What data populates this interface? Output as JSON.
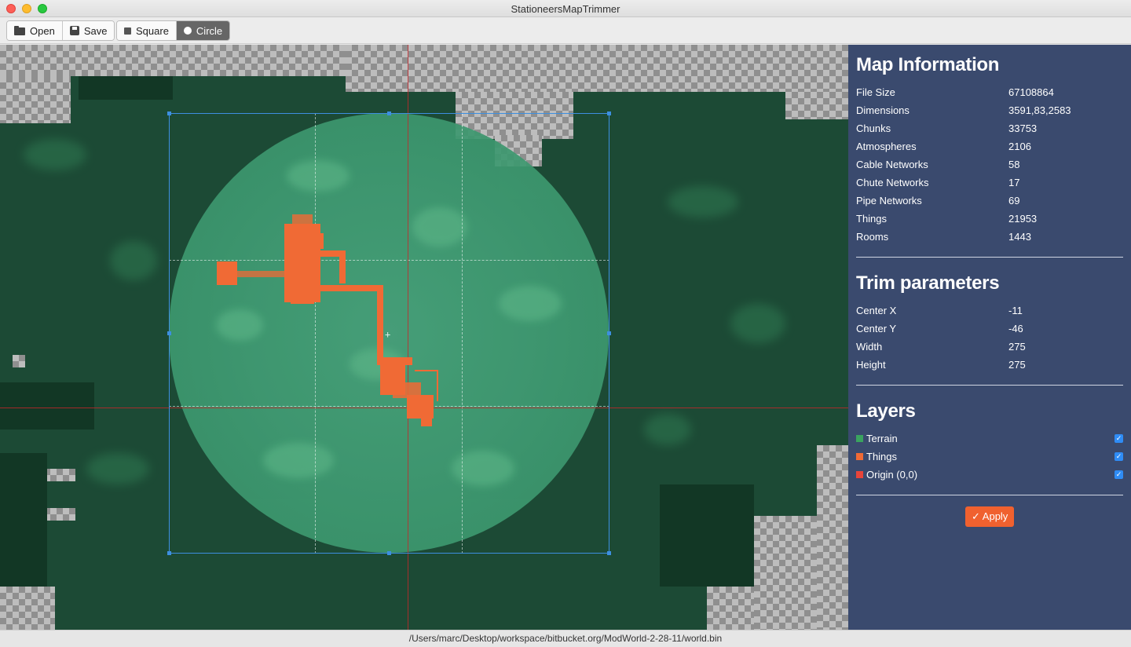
{
  "window": {
    "title": "StationeersMapTrimmer"
  },
  "toolbar": {
    "open_label": "Open",
    "save_label": "Save",
    "square_label": "Square",
    "circle_label": "Circle",
    "active_shape": "Circle"
  },
  "map_info": {
    "title": "Map Information",
    "rows": [
      {
        "label": "File Size",
        "value": "67108864"
      },
      {
        "label": "Dimensions",
        "value": "3591,83,2583"
      },
      {
        "label": "Chunks",
        "value": "33753"
      },
      {
        "label": "Atmospheres",
        "value": "2106"
      },
      {
        "label": "Cable Networks",
        "value": "58"
      },
      {
        "label": "Chute Networks",
        "value": "17"
      },
      {
        "label": "Pipe Networks",
        "value": "69"
      },
      {
        "label": "Things",
        "value": "21953"
      },
      {
        "label": "Rooms",
        "value": "1443"
      }
    ]
  },
  "trim": {
    "title": "Trim parameters",
    "rows": [
      {
        "label": "Center X",
        "value": "-11"
      },
      {
        "label": "Center Y",
        "value": "-46"
      },
      {
        "label": "Width",
        "value": "275"
      },
      {
        "label": "Height",
        "value": "275"
      }
    ]
  },
  "layers": {
    "title": "Layers",
    "items": [
      {
        "label": "Terrain",
        "color": "#3aa35f",
        "checked": true
      },
      {
        "label": "Things",
        "color": "#f06a35",
        "checked": true
      },
      {
        "label": "Origin (0,0)",
        "color": "#e8443a",
        "checked": true
      }
    ]
  },
  "apply_label": "✓ Apply",
  "status": {
    "path": "/Users/marc/Desktop/workspace/bitbucket.org/ModWorld-2-28-11/world.bin"
  },
  "colors": {
    "panel_bg": "#3a4a6e",
    "accent": "#f0612f",
    "selection": "#3d8fe0",
    "origin": "#c8262b"
  }
}
